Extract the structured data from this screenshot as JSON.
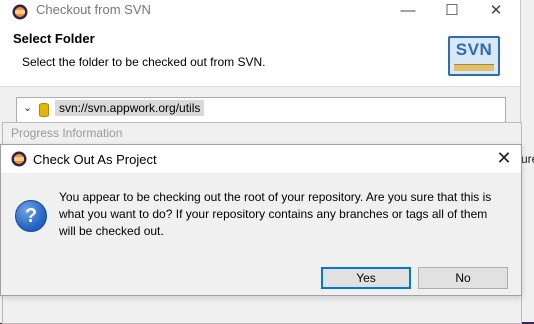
{
  "background": {
    "fragment_text": "ure"
  },
  "svn_window": {
    "title": "Checkout from SVN",
    "header_title": "Select Folder",
    "header_desc": "Select the folder to be checked out from SVN.",
    "logo_text": "SVN",
    "repo_url": "svn://svn.appwork.org/utils",
    "controls": {
      "minimize": "—",
      "maximize": "☐",
      "close": "✕"
    }
  },
  "progress_window": {
    "title": "Progress Information"
  },
  "dialog": {
    "title": "Check Out As Project",
    "close_glyph": "✕",
    "question_glyph": "?",
    "message_line1": "You appear to be checking out the root of your repository.  Are you sure that this is",
    "message_line2": "what you want to do?  If your repository contains any branches or tags all of them",
    "message_line3": "will be checked out.",
    "yes_label": "Yes",
    "no_label": "No"
  },
  "icons": {
    "app": "eclipse-icon",
    "expand": "chevron-down-icon",
    "repo": "database-icon",
    "question": "question-icon"
  },
  "colors": {
    "accent": "#0078d7",
    "logo": "#2f6db3",
    "question": "#1f5fbf"
  }
}
